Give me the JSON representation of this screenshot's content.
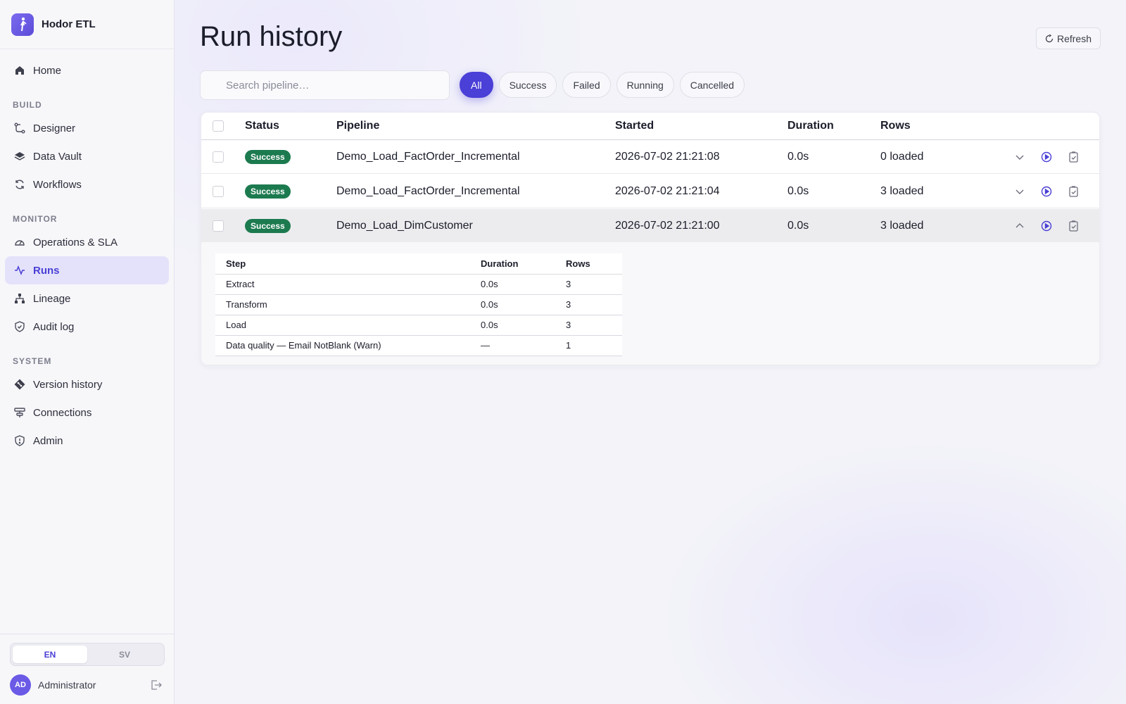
{
  "app": {
    "name": "Hodor ETL"
  },
  "sidebar": {
    "home": {
      "label": "Home",
      "icon": "home-icon"
    },
    "sections": {
      "build": "BUILD",
      "monitor": "MONITOR",
      "system": "SYSTEM"
    },
    "build_items": [
      {
        "label": "Designer",
        "icon": "designer-icon"
      },
      {
        "label": "Data Vault",
        "icon": "layers-icon"
      },
      {
        "label": "Workflows",
        "icon": "refresh-cycle-icon"
      }
    ],
    "monitor_items": [
      {
        "label": "Operations & SLA",
        "icon": "gauge-icon"
      },
      {
        "label": "Runs",
        "icon": "activity-icon",
        "active": true
      },
      {
        "label": "Lineage",
        "icon": "hierarchy-icon"
      },
      {
        "label": "Audit log",
        "icon": "shield-check-icon"
      }
    ],
    "system_items": [
      {
        "label": "Version history",
        "icon": "git-icon"
      },
      {
        "label": "Connections",
        "icon": "connections-icon"
      },
      {
        "label": "Admin",
        "icon": "shield-alert-icon"
      }
    ],
    "language": {
      "options": [
        "EN",
        "SV"
      ],
      "selected": "EN"
    },
    "user": {
      "initials": "AD",
      "name": "Administrator"
    }
  },
  "page": {
    "title": "Run history",
    "refresh_label": "Refresh",
    "search_placeholder": "Search pipeline…",
    "filters": [
      "All",
      "Success",
      "Failed",
      "Running",
      "Cancelled"
    ],
    "active_filter": "All"
  },
  "table": {
    "columns": [
      "Status",
      "Pipeline",
      "Started",
      "Duration",
      "Rows"
    ],
    "rows": [
      {
        "status": "Success",
        "pipeline": "Demo_Load_FactOrder_Incremental",
        "started": "2026-07-02 21:21:08",
        "duration": "0.0s",
        "rows": "0 loaded",
        "expanded": false
      },
      {
        "status": "Success",
        "pipeline": "Demo_Load_FactOrder_Incremental",
        "started": "2026-07-02 21:21:04",
        "duration": "0.0s",
        "rows": "3 loaded",
        "expanded": false
      },
      {
        "status": "Success",
        "pipeline": "Demo_Load_DimCustomer",
        "started": "2026-07-02 21:21:00",
        "duration": "0.0s",
        "rows": "3 loaded",
        "expanded": true
      }
    ],
    "detail": {
      "columns": [
        "Step",
        "Duration",
        "Rows"
      ],
      "steps": [
        {
          "step": "Extract",
          "duration": "0.0s",
          "rows": "3"
        },
        {
          "step": "Transform",
          "duration": "0.0s",
          "rows": "3"
        },
        {
          "step": "Load",
          "duration": "0.0s",
          "rows": "3"
        },
        {
          "step": "Data quality — Email NotBlank (Warn)",
          "duration": "—",
          "rows": "1"
        }
      ]
    }
  },
  "colors": {
    "accent": "#4a3fd6",
    "success": "#1c7a4f",
    "active_nav_bg": "#e4e2fa"
  }
}
